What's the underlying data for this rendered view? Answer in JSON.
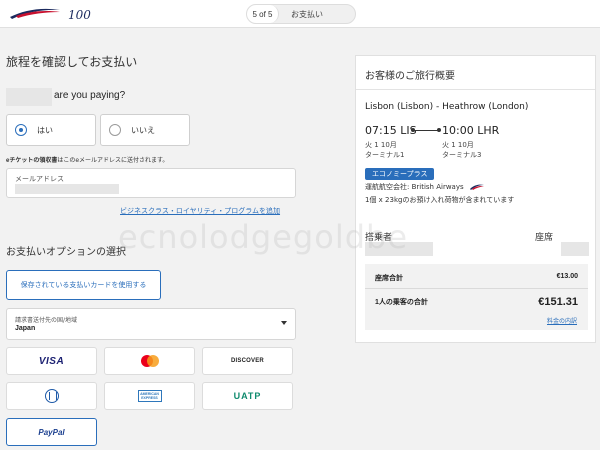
{
  "header": {
    "step_count": "5 of 5",
    "step_label": "お支払い"
  },
  "left": {
    "page_title": "旅程を確認してお支払い",
    "question": "are you paying?",
    "radio_yes": "はい",
    "radio_no": "いいえ",
    "eticket_bold": "eチケットの領収書",
    "eticket_rest": "はこのeメールアドレスに送付されます。",
    "email_label": "メールアドレス",
    "loyalty_link": "ビジネスクラス・ロイヤリティ・プログラムを追加",
    "options_title": "お支払いオプションの選択",
    "saved_card_button": "保存されている支払いカードを使用する",
    "country_label": "請求書送付先の国/地域",
    "country_value": "Japan",
    "payment_methods": {
      "visa": "VISA",
      "discover": "DISCOVER",
      "uatp": "UATP",
      "paypal": "PayPal",
      "amex_line1": "AMERICAN",
      "amex_line2": "EXPRESS"
    }
  },
  "summary": {
    "title": "お客様のご旅行概要",
    "route": "Lisbon (Lisbon) - Heathrow (London)",
    "departure_time": "07:15 LIS",
    "arrival_time": "10:00 LHR",
    "dep_date": "火 1 10月",
    "dep_terminal": "ターミナル1",
    "arr_date": "火 1 10月",
    "arr_terminal": "ターミナル3",
    "cabin": "エコノミープラス",
    "operated_by": "運航航空会社: British Airways",
    "baggage": "1個 x 23kgのお預け入れ荷物が含まれています",
    "passenger_header": "搭乗者",
    "seat_header": "座席",
    "seat_total_label": "座席合計",
    "seat_total_value": "€13.00",
    "pax_total_label": "1人の乗客の合計",
    "pax_total_value": "€151.31",
    "breakdown_link": "料金の内訳"
  },
  "watermark": "ecnolodgegoldbe",
  "colors": {
    "accent_blue": "#2a6ebb",
    "ba_red": "#c8102e",
    "ba_navy": "#1b2a5e"
  }
}
